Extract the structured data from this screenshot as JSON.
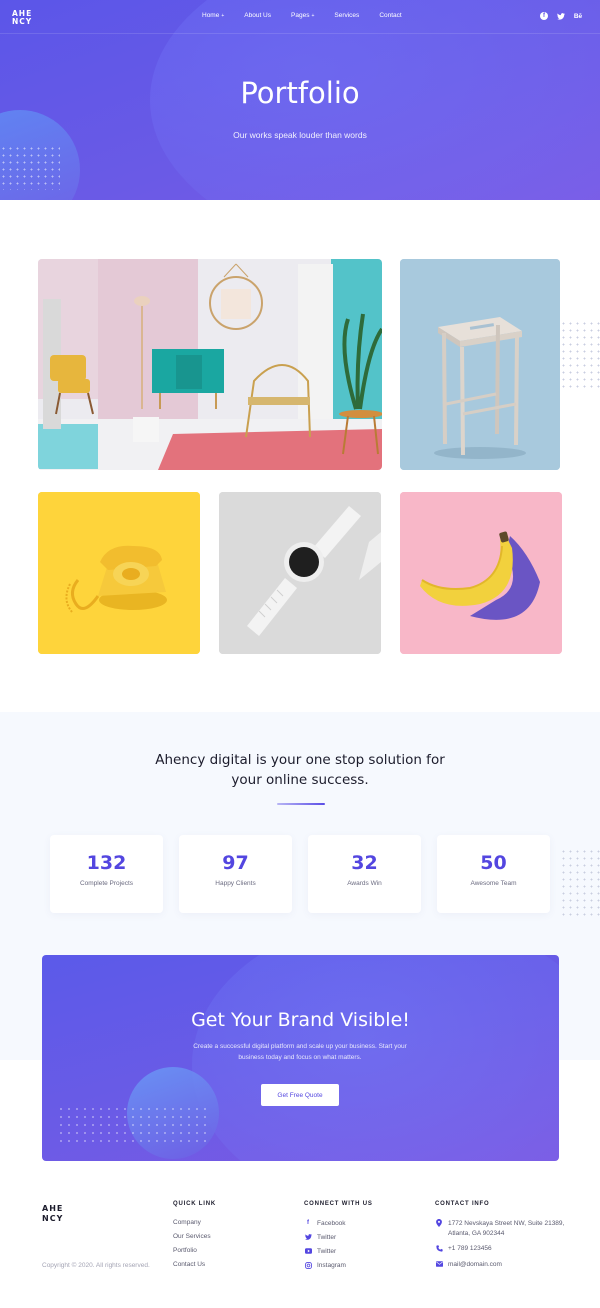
{
  "header": {
    "logo": "AHE NCY",
    "nav": [
      {
        "label": "Home",
        "has_dropdown": true
      },
      {
        "label": "About Us",
        "has_dropdown": false
      },
      {
        "label": "Pages",
        "has_dropdown": true
      },
      {
        "label": "Services",
        "has_dropdown": false
      },
      {
        "label": "Contact",
        "has_dropdown": false
      }
    ],
    "social": [
      "facebook-icon",
      "twitter-icon",
      "behance-icon"
    ],
    "social_text": {
      "twitter": "🐦",
      "behance": "Bē"
    }
  },
  "hero": {
    "title": "Portfolio",
    "subtitle": "Our works speak louder than words"
  },
  "portfolio": {
    "items": [
      {
        "subject": "living room interior",
        "background": "#e7e6ec"
      },
      {
        "subject": "wooden stool",
        "background": "#a6c7dc"
      },
      {
        "subject": "yellow rotary telephone",
        "background": "#fdd43a"
      },
      {
        "subject": "smart watch",
        "background": "#d9d9d9"
      },
      {
        "subject": "banana",
        "background": "#f7b8c8"
      }
    ]
  },
  "stats": {
    "heading_line1": "Ahency digital is your one stop solution for",
    "heading_line2": "your online success.",
    "items": [
      {
        "value": "132",
        "label": "Complete Projects"
      },
      {
        "value": "97",
        "label": "Happy Clients"
      },
      {
        "value": "32",
        "label": "Awards Win"
      },
      {
        "value": "50",
        "label": "Awesome Team"
      }
    ]
  },
  "cta": {
    "title": "Get Your Brand Visible!",
    "text": "Create a successful digital platform and scale up your business. Start your business today and focus on what matters.",
    "button": "Get Free Quote"
  },
  "footer": {
    "logo": "AHE NCY",
    "copyright": "Copyright © 2020. All rights reserved.",
    "quick_link": {
      "title": "QUICK LINK",
      "links": [
        "Company",
        "Our Services",
        "Portfolio",
        "Contact Us"
      ]
    },
    "connect": {
      "title": "CONNECT WITH US",
      "links": [
        "Facebook",
        "Twitter",
        "Twitter",
        "Instagram"
      ],
      "icon_text": [
        "f",
        "🐦",
        "▶",
        "◎"
      ]
    },
    "contact": {
      "title": "CONTACT INFO",
      "address_line1": "1772 Nevskaya Street NW, Suite 21389,",
      "address_line2": "Atlanta, GA 902344",
      "phone": "+1 789 123456",
      "email": "mail@domain.com"
    }
  },
  "colors": {
    "accent": "#5346e0",
    "hero_gradient_start": "#5b56e8",
    "hero_gradient_end": "#7a5be5",
    "stats_bg": "#f6f9fe"
  }
}
